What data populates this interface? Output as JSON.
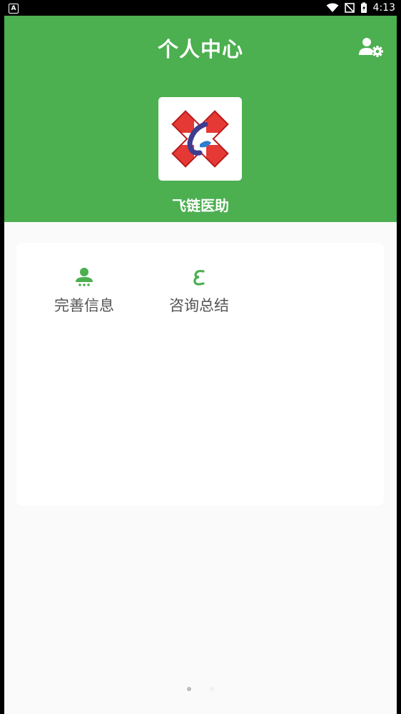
{
  "status_bar": {
    "time": "4:13",
    "notification_badge": "A"
  },
  "header": {
    "title": "个人中心",
    "settings_icon": "user-settings-icon",
    "app_name": "飞链医助",
    "logo_icon": "medical-cross-logo",
    "color": "#4caf50"
  },
  "menu": {
    "items": [
      {
        "label": "完善信息",
        "icon": "user-info-icon"
      },
      {
        "label": "咨询总结",
        "icon": "consult-summary-icon"
      }
    ]
  }
}
